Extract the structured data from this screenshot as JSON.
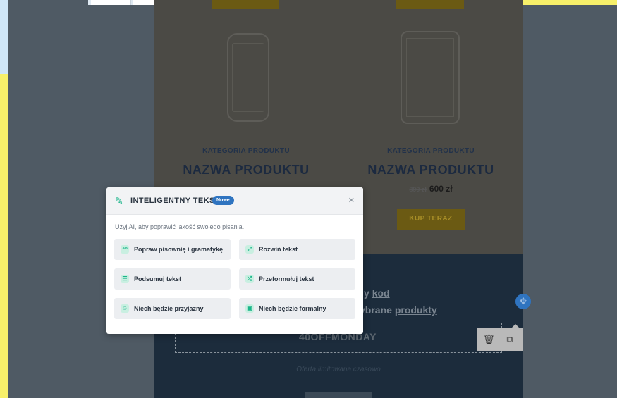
{
  "product_left": {
    "category": "KATEGORIA PRODUKTU",
    "name": "NAZWA PRODUKTU"
  },
  "product_right": {
    "category": "KATEGORIA PRODUKTU",
    "name": "NAZWA PRODUKTU",
    "old_price": "899 zł",
    "price": "600 zł",
    "buy_label": "KUP TERAZ"
  },
  "promo": {
    "line1_prefix": "y ",
    "line1_link": "kod",
    "line2_prefix": "ybrane ",
    "line2_link": "produkty",
    "code": "40OFFMONDAY",
    "limited": "Oferta limitowana czasowo"
  },
  "modal": {
    "title": "INTELIGENTNY TEKST",
    "badge": "Nowe",
    "description": "Użyj AI, aby poprawić jakość swojego pisania.",
    "options": [
      {
        "label": "Popraw pisownię i gramatykę",
        "icon": "spellcheck-icon"
      },
      {
        "label": "Rozwiń tekst",
        "icon": "expand-icon"
      },
      {
        "label": "Podsumuj tekst",
        "icon": "list-icon"
      },
      {
        "label": "Przeformułuj tekst",
        "icon": "shuffle-icon"
      },
      {
        "label": "Niech będzie przyjazny",
        "icon": "smile-icon"
      },
      {
        "label": "Niech będzie formalny",
        "icon": "briefcase-icon"
      }
    ]
  },
  "colors": {
    "accent": "#2f74c0",
    "ai_green": "#1bb58a",
    "gold": "#c9a227",
    "navy": "#1c2c3c"
  }
}
